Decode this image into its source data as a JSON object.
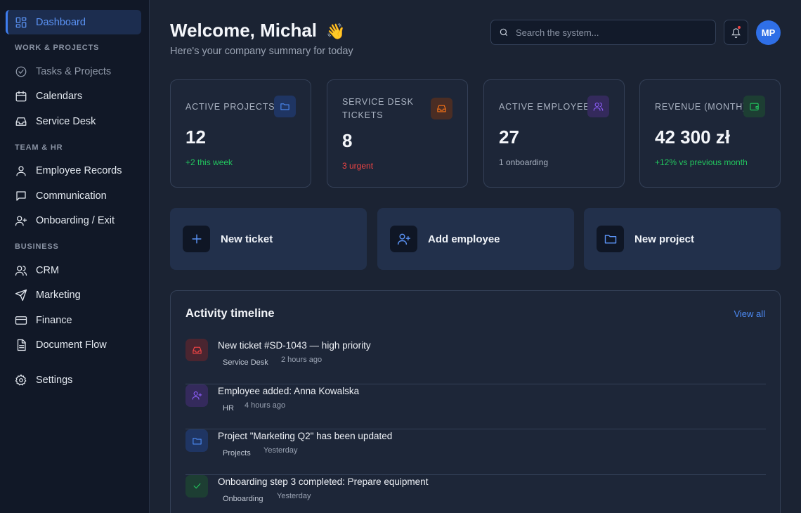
{
  "sidebar": {
    "active": {
      "label": "Dashboard",
      "icon": "dashboard-icon"
    },
    "sections": [
      {
        "title": "WORK & PROJECTS",
        "items": [
          {
            "label": "Tasks & Projects",
            "icon": "check-circle-icon"
          },
          {
            "label": "Calendars",
            "icon": "calendar-icon"
          },
          {
            "label": "Service Desk",
            "icon": "inbox-icon"
          }
        ]
      },
      {
        "title": "TEAM & HR",
        "items": [
          {
            "label": "Employee Records",
            "icon": "user-icon"
          },
          {
            "label": "Communication",
            "icon": "message-icon"
          },
          {
            "label": "Onboarding / Exit",
            "icon": "user-plus-icon"
          }
        ]
      },
      {
        "title": "BUSINESS",
        "items": [
          {
            "label": "CRM",
            "icon": "users-icon"
          },
          {
            "label": "Marketing",
            "icon": "send-icon"
          },
          {
            "label": "Finance",
            "icon": "credit-card-icon"
          },
          {
            "label": "Document Flow",
            "icon": "document-icon"
          }
        ]
      }
    ],
    "settings": {
      "label": "Settings",
      "icon": "gear-icon"
    }
  },
  "header": {
    "title": "Welcome, Michal",
    "emoji": "👋",
    "subtitle": "Here's your company summary for today",
    "search_placeholder": "Search the system...",
    "avatar_initials": "MP"
  },
  "stats": [
    {
      "label": "ACTIVE PROJECTS",
      "value": "12",
      "note": "+2 this week",
      "note_color": "#22c55e",
      "icon": "folder-icon",
      "accent": "#3b82f6"
    },
    {
      "label": "SERVICE DESK TICKETS",
      "value": "8",
      "note": "3 urgent",
      "note_color": "#ef4444",
      "icon": "inbox-icon",
      "accent": "#f97316"
    },
    {
      "label": "ACTIVE EMPLOYEES",
      "value": "27",
      "note": "1 onboarding",
      "note_color": "#aab3c2",
      "icon": "users-icon",
      "accent": "#8b5cf6"
    },
    {
      "label": "REVENUE (MONTH)",
      "value": "42 300 zł",
      "note": "+12% vs previous month",
      "note_color": "#22c55e",
      "icon": "wallet-icon",
      "accent": "#22c55e"
    }
  ],
  "actions": [
    {
      "label": "New ticket",
      "icon": "plus-icon"
    },
    {
      "label": "Add employee",
      "icon": "user-plus-icon"
    },
    {
      "label": "New project",
      "icon": "folder-icon"
    }
  ],
  "timeline": {
    "title": "Activity timeline",
    "view_all": "View all",
    "items": [
      {
        "text": "New ticket #SD-1043 — high priority",
        "tag": "Service Desk",
        "time": "2 hours ago",
        "icon": "inbox-icon",
        "accent": "#ef4444"
      },
      {
        "text": "Employee added: Anna Kowalska",
        "tag": "HR",
        "time": "4 hours ago",
        "icon": "user-plus-icon",
        "accent": "#8b5cf6"
      },
      {
        "text": "Project \"Marketing Q2\" has been updated",
        "tag": "Projects",
        "time": "Yesterday",
        "icon": "folder-icon",
        "accent": "#3b82f6"
      },
      {
        "text": "Onboarding step 3 completed: Prepare equipment",
        "tag": "Onboarding",
        "time": "Yesterday",
        "icon": "check-icon",
        "accent": "#22c55e"
      }
    ]
  }
}
